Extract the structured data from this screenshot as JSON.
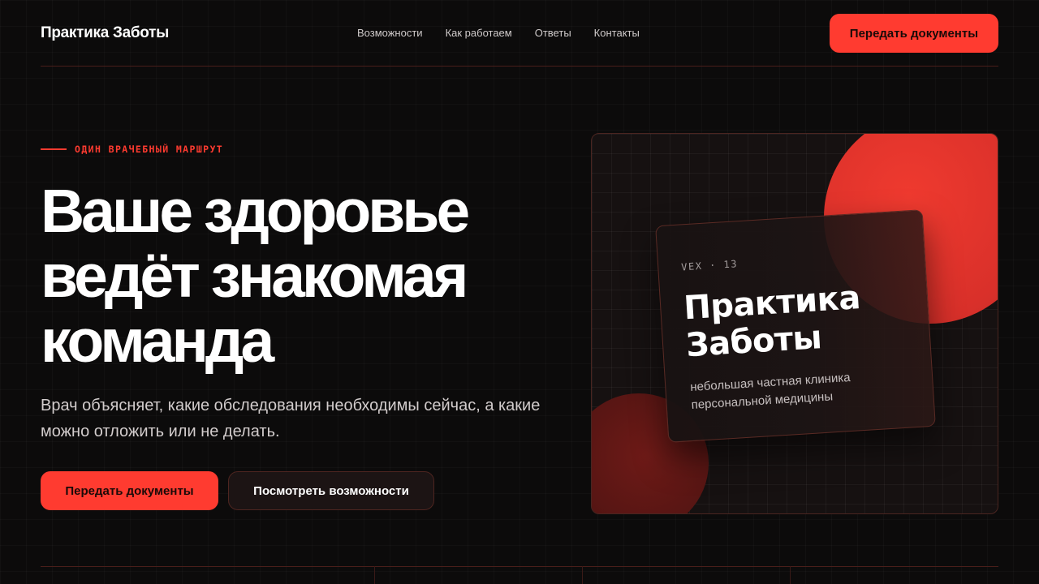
{
  "header": {
    "brand": "Практика Заботы",
    "nav": [
      "Возможности",
      "Как работаем",
      "Ответы",
      "Контакты"
    ],
    "cta": "Передать документы"
  },
  "hero": {
    "eyebrow": "ОДИН ВРАЧЕБНЫЙ МАРШРУТ",
    "headline_lines": [
      "Ваше здоровье",
      "ведёт знакомая",
      "команда"
    ],
    "lead": "Врач объясняет, какие обследования необходимы сейчас, а какие можно отложить или не делать.",
    "primary_button": "Передать документы",
    "secondary_button": "Посмотреть возможности"
  },
  "visual_card": {
    "tag": "VEX · 13",
    "title_lines": [
      "Практика",
      "Заботы"
    ],
    "subtitle_lines": [
      "небольшая частная клиника",
      "персональной медицины"
    ]
  },
  "colors": {
    "accent": "#ff3b30",
    "background": "#0c0b0b",
    "border": "#4a1e1a"
  }
}
